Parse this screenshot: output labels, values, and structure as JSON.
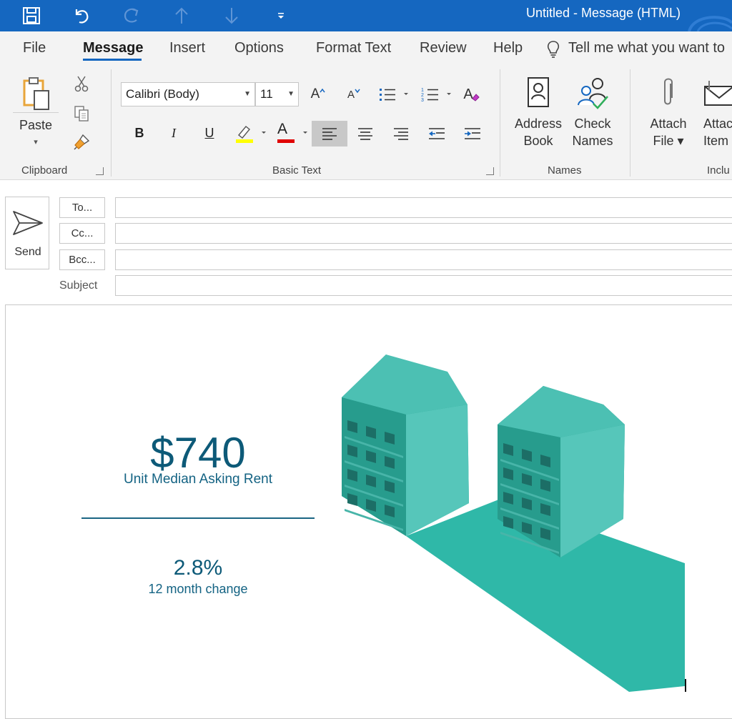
{
  "titlebar": {
    "title": "Untitled  -  Message (HTML)",
    "icons": [
      "save-icon",
      "undo-icon",
      "redo-icon",
      "previous-item-icon",
      "next-item-icon",
      "customize-toolbar-icon"
    ]
  },
  "menu": {
    "tabs": [
      "File",
      "Message",
      "Insert",
      "Options",
      "Format Text",
      "Review",
      "Help"
    ],
    "active_tab": "Message",
    "tell_me": "Tell me what you want to"
  },
  "ribbon": {
    "clipboard": {
      "label": "Clipboard",
      "paste": "Paste",
      "paste_caret": "▾",
      "cut_icon": "scissors-icon",
      "copy_icon": "copy-icon",
      "format_painter_icon": "format-painter-icon"
    },
    "basic_text": {
      "label": "Basic Text",
      "font_name": "Calibri (Body)",
      "font_size": "11",
      "bold": "B",
      "italic": "I",
      "underline": "U",
      "grow_font": "A",
      "shrink_font": "A",
      "clear_format": "A",
      "font_color_letter": "A",
      "highlight_color": "#ffff00",
      "font_color": "#e00000"
    },
    "names": {
      "label": "Names",
      "address_book": [
        "Address",
        "Book"
      ],
      "check_names": [
        "Check",
        "Names"
      ]
    },
    "include": {
      "label": "Inclu",
      "attach_file": [
        "Attach",
        "File ▾"
      ],
      "attach_item": [
        "Attac",
        "Item"
      ]
    }
  },
  "compose": {
    "send": "Send",
    "to": "To...",
    "cc": "Cc...",
    "bcc": "Bcc...",
    "subject_label": "Subject",
    "to_value": "",
    "cc_value": "",
    "bcc_value": "",
    "subject_value": ""
  },
  "body": {
    "rent_value": "$740",
    "rent_label": "Unit Median Asking Rent",
    "change_value": "2.8%",
    "change_label": "12 month change",
    "accent_color": "#0d5a78",
    "building_color": "#2fb8a8"
  }
}
